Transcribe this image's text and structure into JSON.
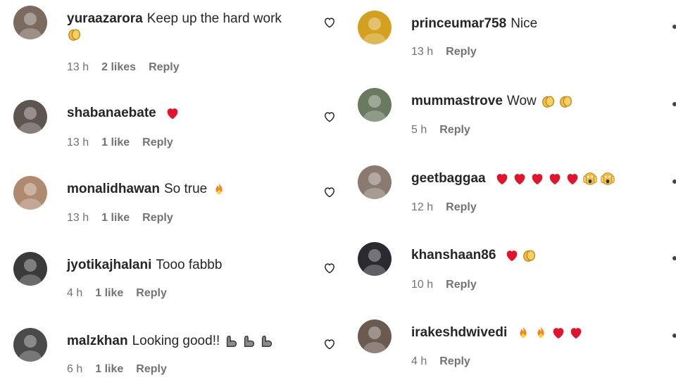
{
  "left_comments": [
    {
      "username": "yuraazarora",
      "text": "Keep up the hard work",
      "emojis": [
        "clap"
      ],
      "time": "13 h",
      "likes": "2 likes",
      "reply": "Reply",
      "avatar_color": "#7a6a60"
    },
    {
      "username": "shabanaebate",
      "text": "",
      "emojis": [
        "heart"
      ],
      "time": "13 h",
      "likes": "1 like",
      "reply": "Reply",
      "avatar_color": "#5e5450"
    },
    {
      "username": "monalidhawan",
      "text": "So true",
      "emojis": [
        "fire"
      ],
      "time": "13 h",
      "likes": "1 like",
      "reply": "Reply",
      "avatar_color": "#b08a70"
    },
    {
      "username": "jyotikajhalani",
      "text": "Tooo fabbb",
      "emojis": [],
      "time": "4 h",
      "likes": "1 like",
      "reply": "Reply",
      "avatar_color": "#3a3a3a"
    },
    {
      "username": "malzkhan",
      "text": "Looking good!!",
      "emojis": [
        "muscle",
        "muscle",
        "muscle"
      ],
      "time": "6 h",
      "likes": "1 like",
      "reply": "Reply",
      "avatar_color": "#4a4a4a"
    }
  ],
  "right_comments": [
    {
      "username": "princeumar758",
      "text": "Nice",
      "emojis": [],
      "time": "13 h",
      "reply": "Reply",
      "avatar_color": "#d4a020"
    },
    {
      "username": "mummastrove",
      "text": "Wow",
      "emojis": [
        "clap",
        "clap"
      ],
      "time": "5 h",
      "reply": "Reply",
      "avatar_color": "#6a7a60"
    },
    {
      "username": "geetbaggaa",
      "text": "",
      "emojis": [
        "heart",
        "heart",
        "heart",
        "heart",
        "heart",
        "scream",
        "scream"
      ],
      "time": "12 h",
      "reply": "Reply",
      "avatar_color": "#8a7a70"
    },
    {
      "username": "khanshaan86",
      "text": "",
      "emojis": [
        "heart",
        "clap"
      ],
      "time": "10 h",
      "reply": "Reply",
      "avatar_color": "#2a2a30"
    },
    {
      "username": "irakeshdwivedi",
      "text": "",
      "emojis": [
        "fire",
        "fire",
        "heart",
        "heart"
      ],
      "time": "4 h",
      "reply": "Reply",
      "avatar_color": "#6a5a50"
    }
  ],
  "colors": {
    "muted": "#737373",
    "heart": "#e0142c",
    "fire": "#f5841f",
    "clap": "#f2c04a"
  },
  "icons": {
    "like": "heart-outline-icon",
    "more": "more-options-icon"
  }
}
